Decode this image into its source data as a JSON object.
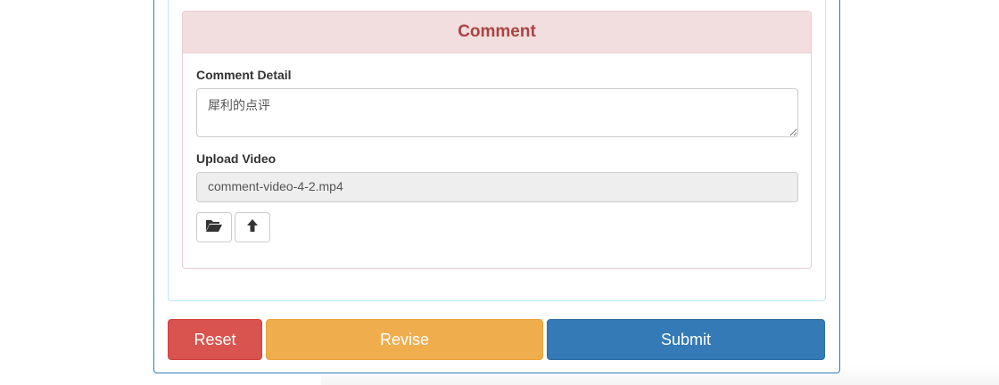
{
  "comment_panel": {
    "title": "Comment",
    "detail_label": "Comment Detail",
    "detail_value": "犀利的点评",
    "upload_label": "Upload Video",
    "file_name": "comment-video-4-2.mp4",
    "browse_icon": "folder-open-icon",
    "upload_icon": "arrow-up-icon"
  },
  "actions": {
    "reset_label": "Reset",
    "revise_label": "Revise",
    "submit_label": "Submit"
  },
  "colors": {
    "danger": "#d9534f",
    "warning": "#f0ad4e",
    "primary": "#337ab7",
    "comment_heading_bg": "#f2dede",
    "comment_heading_text": "#a94442"
  }
}
